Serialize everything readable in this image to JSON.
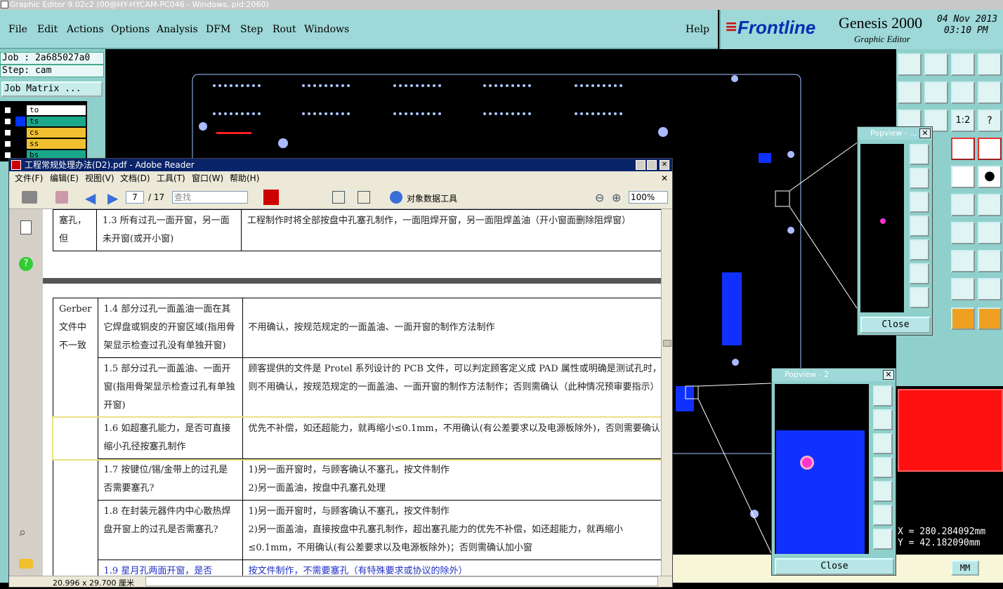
{
  "app": {
    "title": "Graphic Editor 9.02c2 (00@HY-HYCAM-PC046 - Windows, pid:2060)",
    "menu": [
      "File",
      "Edit",
      "Actions",
      "Options",
      "Analysis",
      "DFM",
      "Step",
      "Rout",
      "Windows"
    ],
    "help": "Help",
    "brand": "Frontline",
    "product": "Genesis 2000",
    "subtitle": "Graphic Editor",
    "date": "04 Nov 2013",
    "time": "03:10 PM"
  },
  "job": {
    "job_label": "Job : 2a685027a0",
    "step_label": "Step: cam",
    "matrix_button": "Job Matrix ...",
    "layers": [
      {
        "name": "to",
        "color": "#000000",
        "bg": "#ffffff"
      },
      {
        "name": "ts",
        "color": "#0033ff",
        "bg": "#1aa88a"
      },
      {
        "name": "cs",
        "color": "#000000",
        "bg": "#f0c030"
      },
      {
        "name": "ss",
        "color": "#000000",
        "bg": "#f0c030"
      },
      {
        "name": "bs",
        "color": "#000000",
        "bg": "#1aa88a"
      }
    ]
  },
  "popview1": {
    "title": "Popview - ...",
    "close": "Close"
  },
  "popview2": {
    "title": "Popview - 2",
    "close": "Close"
  },
  "coords": {
    "x": "X = 280.284092mm",
    "y": "Y = 42.182090mm",
    "unit": "MM"
  },
  "reader": {
    "title": "工程常规处理办法(D2).pdf - Adobe Reader",
    "menu": [
      "文件(F)",
      "编辑(E)",
      "视图(V)",
      "文档(D)",
      "工具(T)",
      "窗口(W)",
      "帮助(H)"
    ],
    "page": "7",
    "total": "/ 17",
    "search_placeholder": "查找",
    "object_tool": "对象数据工具",
    "zoom": "100%",
    "page_size": "20.996 x 29.700 厘米",
    "top_rows": [
      {
        "c1": "塞孔，但",
        "c2": "1.3 所有过孔一面开窗，另一面未开窗(或开小窗)",
        "c3": "工程制作时将全部按盘中孔塞孔制作，一面阻焊开窗，另一面阻焊盖油（开小窗面删除阻焊窗）"
      }
    ],
    "group_label": "Gerber文件中不一致",
    "rows": [
      {
        "c2": "1.4 部分过孔一面盖油一面在其它焊盘或铜皮的开窗区域(指用骨架显示检查过孔没有单独开窗)",
        "c3": "不用确认，按规范规定的一面盖油、一面开窗的制作方法制作"
      },
      {
        "c2": "1.5 部分过孔一面盖油、一面开窗(指用骨架显示检查过孔有单独开窗)",
        "c3": "顾客提供的文件是 Protel 系列设计的 PCB 文件，可以判定顾客定义成 PAD 属性或明确是测试孔时，则不用确认，按规范规定的一面盖油、一面开窗的制作方法制作；否则需确认（此种情况预审要指示）"
      },
      {
        "c2": "1.6 如超塞孔能力，是否可直接缩小孔径按塞孔制作",
        "c3": "优先不补偿，如还超能力，就再缩小≤0.1mm，不用确认(有公差要求以及电源板除外)，否则需要确认"
      },
      {
        "c2": "1.7 按键位/锡/金带上的过孔是否需要塞孔?",
        "c3": "1)另一面开窗时，与顾客确认不塞孔，按文件制作\n2)另一面盖油，按盘中孔塞孔处理"
      },
      {
        "c2": "1.8 在封装元器件内中心散热焊盘开窗上的过孔是否需塞孔?",
        "c3": "1)另一面开窗时，与顾客确认不塞孔，按文件制作\n2)另一面盖油，直接按盘中孔塞孔制作，超出塞孔能力的优先不补偿，如还超能力，就再缩小≤0.1mm，不用确认(有公差要求以及电源板除外)；否则需确认加小窗"
      },
      {
        "c2": "1.9 星月孔两面开窗，是否",
        "c3": "按文件制作，不需要塞孔（有特殊要求或协议的除外）"
      }
    ]
  }
}
